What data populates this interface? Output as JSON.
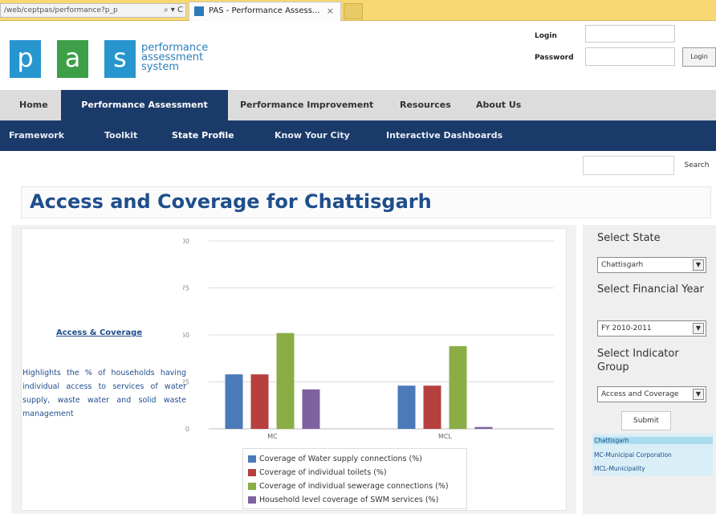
{
  "browser": {
    "address": "/web/ceptpas/performance?p_p",
    "address_controls": "⌕ ▾ C",
    "tab_title": "PAS - Performance Assess...",
    "tab_close": "×"
  },
  "logo": {
    "letters": [
      "p",
      "a",
      "s"
    ],
    "text_lines": [
      "performance",
      "assessment",
      "system"
    ]
  },
  "login": {
    "login_label": "Login",
    "password_label": "Password",
    "button_label": "Login"
  },
  "nav_primary": [
    {
      "label": "Home"
    },
    {
      "label": "Performance Assessment"
    },
    {
      "label": "Performance Improvement"
    },
    {
      "label": "Resources"
    },
    {
      "label": "About Us"
    }
  ],
  "nav_secondary": [
    {
      "label": "Framework"
    },
    {
      "label": "Toolkit"
    },
    {
      "label": "State Profile"
    },
    {
      "label": "Know Your City"
    },
    {
      "label": "Interactive Dashboards"
    }
  ],
  "search": {
    "button_label": "Search"
  },
  "page_title": "Access and Coverage for Chattisgarh",
  "description": {
    "heading": "Access & Coverage",
    "text": "Highlights the % of households having individual access to services of water supply, waste water and solid waste management"
  },
  "sidebar": {
    "state_label": "Select State",
    "state_value": "Chattisgarh",
    "fy_label": "Select Financial Year",
    "fy_value": "FY 2010-2011",
    "indicator_label": "Select Indicator Group",
    "indicator_value": "Access and Coverage",
    "submit_label": "Submit",
    "dropdown_glyph": "▼",
    "key": [
      "Chattisgarh",
      "MC-Municipal Corporation",
      "MCL-Municipality"
    ]
  },
  "chart_data": {
    "type": "bar",
    "categories": [
      "MC",
      "MCL"
    ],
    "ylim": [
      0,
      100
    ],
    "yticks": [
      0,
      25,
      50,
      75,
      100
    ],
    "grid": true,
    "legend_placement": "bottom",
    "series": [
      {
        "name": "Coverage of Water supply connections (%)",
        "values": [
          29,
          23
        ],
        "color": "#4a7ab8"
      },
      {
        "name": "Coverage of individual toilets (%)",
        "values": [
          29,
          23
        ],
        "color": "#b5403f"
      },
      {
        "name": "Coverage of individual sewerage connections (%)",
        "values": [
          51,
          44
        ],
        "color": "#8aae45"
      },
      {
        "name": "Household level coverage of SWM services (%)",
        "values": [
          21,
          1
        ],
        "color": "#7e62a0"
      }
    ]
  }
}
